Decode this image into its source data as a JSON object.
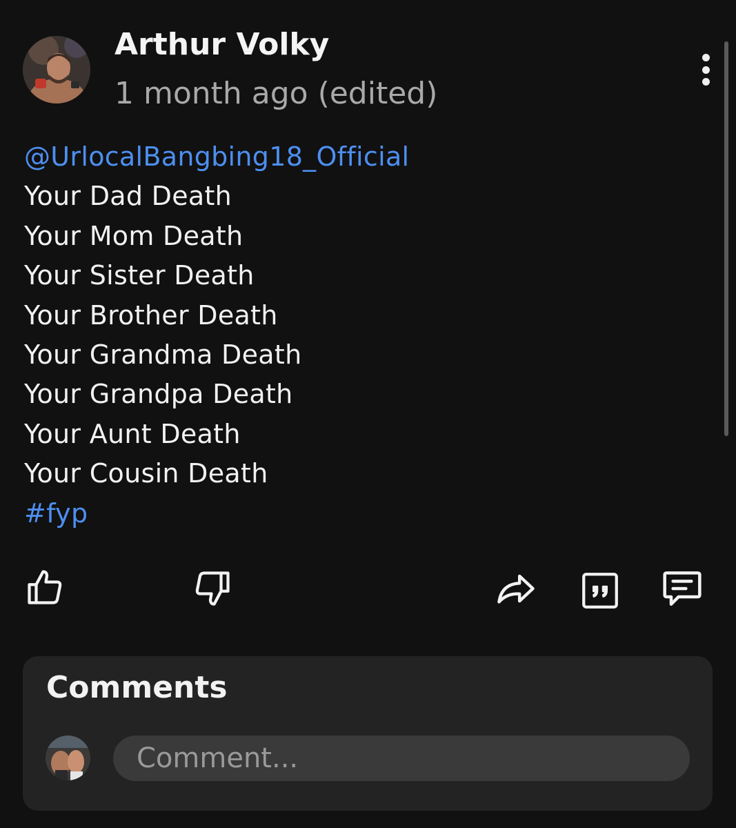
{
  "post": {
    "author": "Arthur Volky",
    "timestamp": "1 month ago (edited)",
    "mention": "@UrlocalBangbing18_Official",
    "lines": [
      "Your Dad Death",
      "Your Mom Death",
      "Your Sister Death",
      "Your Brother Death",
      "Your Grandma Death",
      "Your Grandpa Death",
      "Your Aunt Death",
      "Your Cousin Death"
    ],
    "hashtag": "#fyp"
  },
  "actions": [
    "like-icon",
    "dislike-icon",
    "share-icon",
    "quote-icon",
    "reply-icon"
  ],
  "comments": {
    "title": "Comments",
    "placeholder": "Comment..."
  },
  "colors": {
    "background": "#111111",
    "link": "#4d8ff0",
    "card": "#232323",
    "input": "#3a3a3a"
  }
}
